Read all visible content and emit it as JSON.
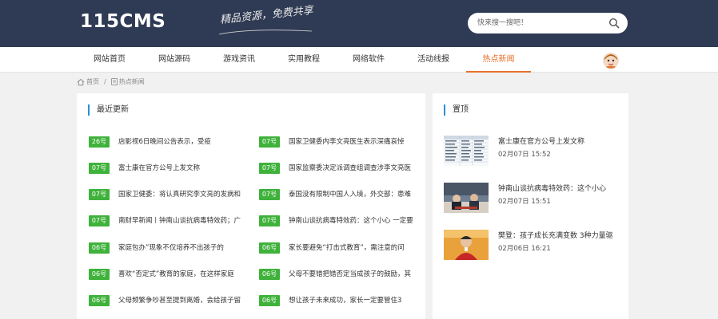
{
  "header": {
    "logo_text": "115CMS",
    "slogan": "精品资源，免费共享",
    "search_placeholder": "快来搜一搜吧！"
  },
  "nav": {
    "items": [
      {
        "label": "网站首页"
      },
      {
        "label": "网站源码"
      },
      {
        "label": "游戏资讯"
      },
      {
        "label": "实用教程"
      },
      {
        "label": "网络软件"
      },
      {
        "label": "活动线报"
      },
      {
        "label": "热点新闻"
      }
    ],
    "active_index": 6
  },
  "breadcrumb": {
    "home": "首页",
    "separator": "/",
    "current": "热点新闻"
  },
  "latest": {
    "title": "最近更新",
    "left_column": [
      {
        "date": "26号",
        "title": "店影视6日晚间公告表示，受疫"
      },
      {
        "date": "07号",
        "title": "富士康在官方公号上发文称"
      },
      {
        "date": "07号",
        "title": "国家卫健委：将认真研究李文亮的发病和"
      },
      {
        "date": "07号",
        "title": "南财早新闻丨钟南山谈抗病毒特效药；广"
      },
      {
        "date": "06号",
        "title": "家庭包办”现象不仅培养不出孩子的"
      },
      {
        "date": "06号",
        "title": "喜欢“否定式”教育的家庭，在这样家庭"
      },
      {
        "date": "06号",
        "title": "父母频繁争吵甚至提到离婚，会给孩子留"
      }
    ],
    "right_column": [
      {
        "date": "07号",
        "title": "国家卫健委内李文亮医生表示深痛哀悼"
      },
      {
        "date": "07号",
        "title": "国家监察委决定派调查组调查涉李文亮医"
      },
      {
        "date": "07号",
        "title": "泰国没有限制中国人入境，外交部：患难"
      },
      {
        "date": "07号",
        "title": "钟南山谈抗病毒特效药：这个小心 一定要"
      },
      {
        "date": "06号",
        "title": "家长要避免“打击式教育”，需注意的问"
      },
      {
        "date": "06号",
        "title": "父母不要错把错否定当成孩子的鼓励，其"
      },
      {
        "date": "06号",
        "title": "想让孩子未来成功，家长一定要管住3"
      }
    ]
  },
  "pinned": {
    "title": "置顶",
    "items": [
      {
        "title": "富士康在官方公号上发文称",
        "date": "02月07日 15:52",
        "thumb": "spreadsheet-thumbnail"
      },
      {
        "title": "钟南山谈抗病毒特效药：这个小心",
        "date": "02月07日 15:51",
        "thumb": "meeting-photo-thumbnail"
      },
      {
        "title": "樊登：孩子成长充满变数 3种力量驱",
        "date": "02月06日 16:21",
        "thumb": "speaker-photo-thumbnail"
      }
    ]
  },
  "colors": {
    "header_bg": "#2f3b54",
    "accent_orange": "#e8702a",
    "badge_green": "#3fb23b",
    "title_bar_blue": "#2b8fd8"
  }
}
